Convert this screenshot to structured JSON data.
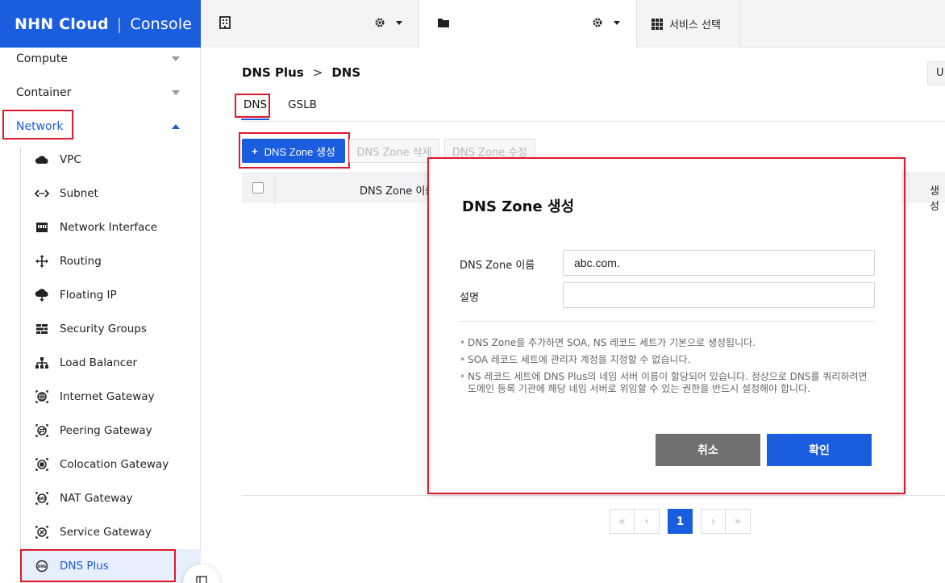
{
  "header": {
    "logo_brand": "NHN Cloud",
    "logo_product": "Console",
    "service_select": "서비스 선택"
  },
  "sidebar": {
    "categories": [
      {
        "label": "Compute",
        "expanded": false
      },
      {
        "label": "Container",
        "expanded": false
      },
      {
        "label": "Network",
        "expanded": true
      }
    ],
    "items": [
      {
        "label": "VPC",
        "icon": "cloud-icon"
      },
      {
        "label": "Subnet",
        "icon": "subnet-icon"
      },
      {
        "label": "Network Interface",
        "icon": "network-interface-icon"
      },
      {
        "label": "Routing",
        "icon": "routing-icon"
      },
      {
        "label": "Floating IP",
        "icon": "floating-ip-icon"
      },
      {
        "label": "Security Groups",
        "icon": "security-groups-icon"
      },
      {
        "label": "Load Balancer",
        "icon": "load-balancer-icon"
      },
      {
        "label": "Internet Gateway",
        "icon": "internet-gateway-icon"
      },
      {
        "label": "Peering Gateway",
        "icon": "peering-gateway-icon"
      },
      {
        "label": "Colocation Gateway",
        "icon": "colocation-gateway-icon"
      },
      {
        "label": "NAT Gateway",
        "icon": "nat-gateway-icon"
      },
      {
        "label": "Service Gateway",
        "icon": "service-gateway-icon"
      },
      {
        "label": "DNS Plus",
        "icon": "dns-icon",
        "selected": true
      }
    ]
  },
  "main": {
    "breadcrumb": {
      "parent": "DNS Plus",
      "current": "DNS"
    },
    "top_right_button": "U",
    "tabs": [
      {
        "label": "DNS",
        "active": true
      },
      {
        "label": "GSLB",
        "active": false
      }
    ],
    "toolbar": {
      "create_label": "DNS Zone 생성",
      "delete_label": "DNS Zone 삭제",
      "edit_label": "DNS Zone 수정"
    },
    "table": {
      "columns": [
        "DNS Zone 이름",
        "생성"
      ]
    },
    "pagination": {
      "current": "1",
      "first": "«",
      "prev": "‹",
      "next": "›",
      "last": "»"
    }
  },
  "modal": {
    "title": "DNS Zone 생성",
    "zone_name_label": "DNS Zone 이름",
    "zone_name_value": "abc.com.",
    "description_label": "설명",
    "description_value": "",
    "notes": [
      "DNS Zone을 추가하면 SOA, NS 레코드 세트가 기본으로 생성됩니다.",
      "SOA 레코드 세트에 관리자 계정을 지정할 수 없습니다.",
      "NS 레코드 세트에 DNS Plus의 네임 서버 이름이 할당되어 있습니다. 정상으로 DNS를 쿼리하려면 도메인 등록 기관에 해당 네임 서버로 위임할 수 있는 권한을 반드시 설정해야 합니다."
    ],
    "cancel_label": "취소",
    "ok_label": "확인"
  },
  "colors": {
    "accent": "#1a5dde",
    "highlight": "#e0182e",
    "cancel": "#707072"
  }
}
